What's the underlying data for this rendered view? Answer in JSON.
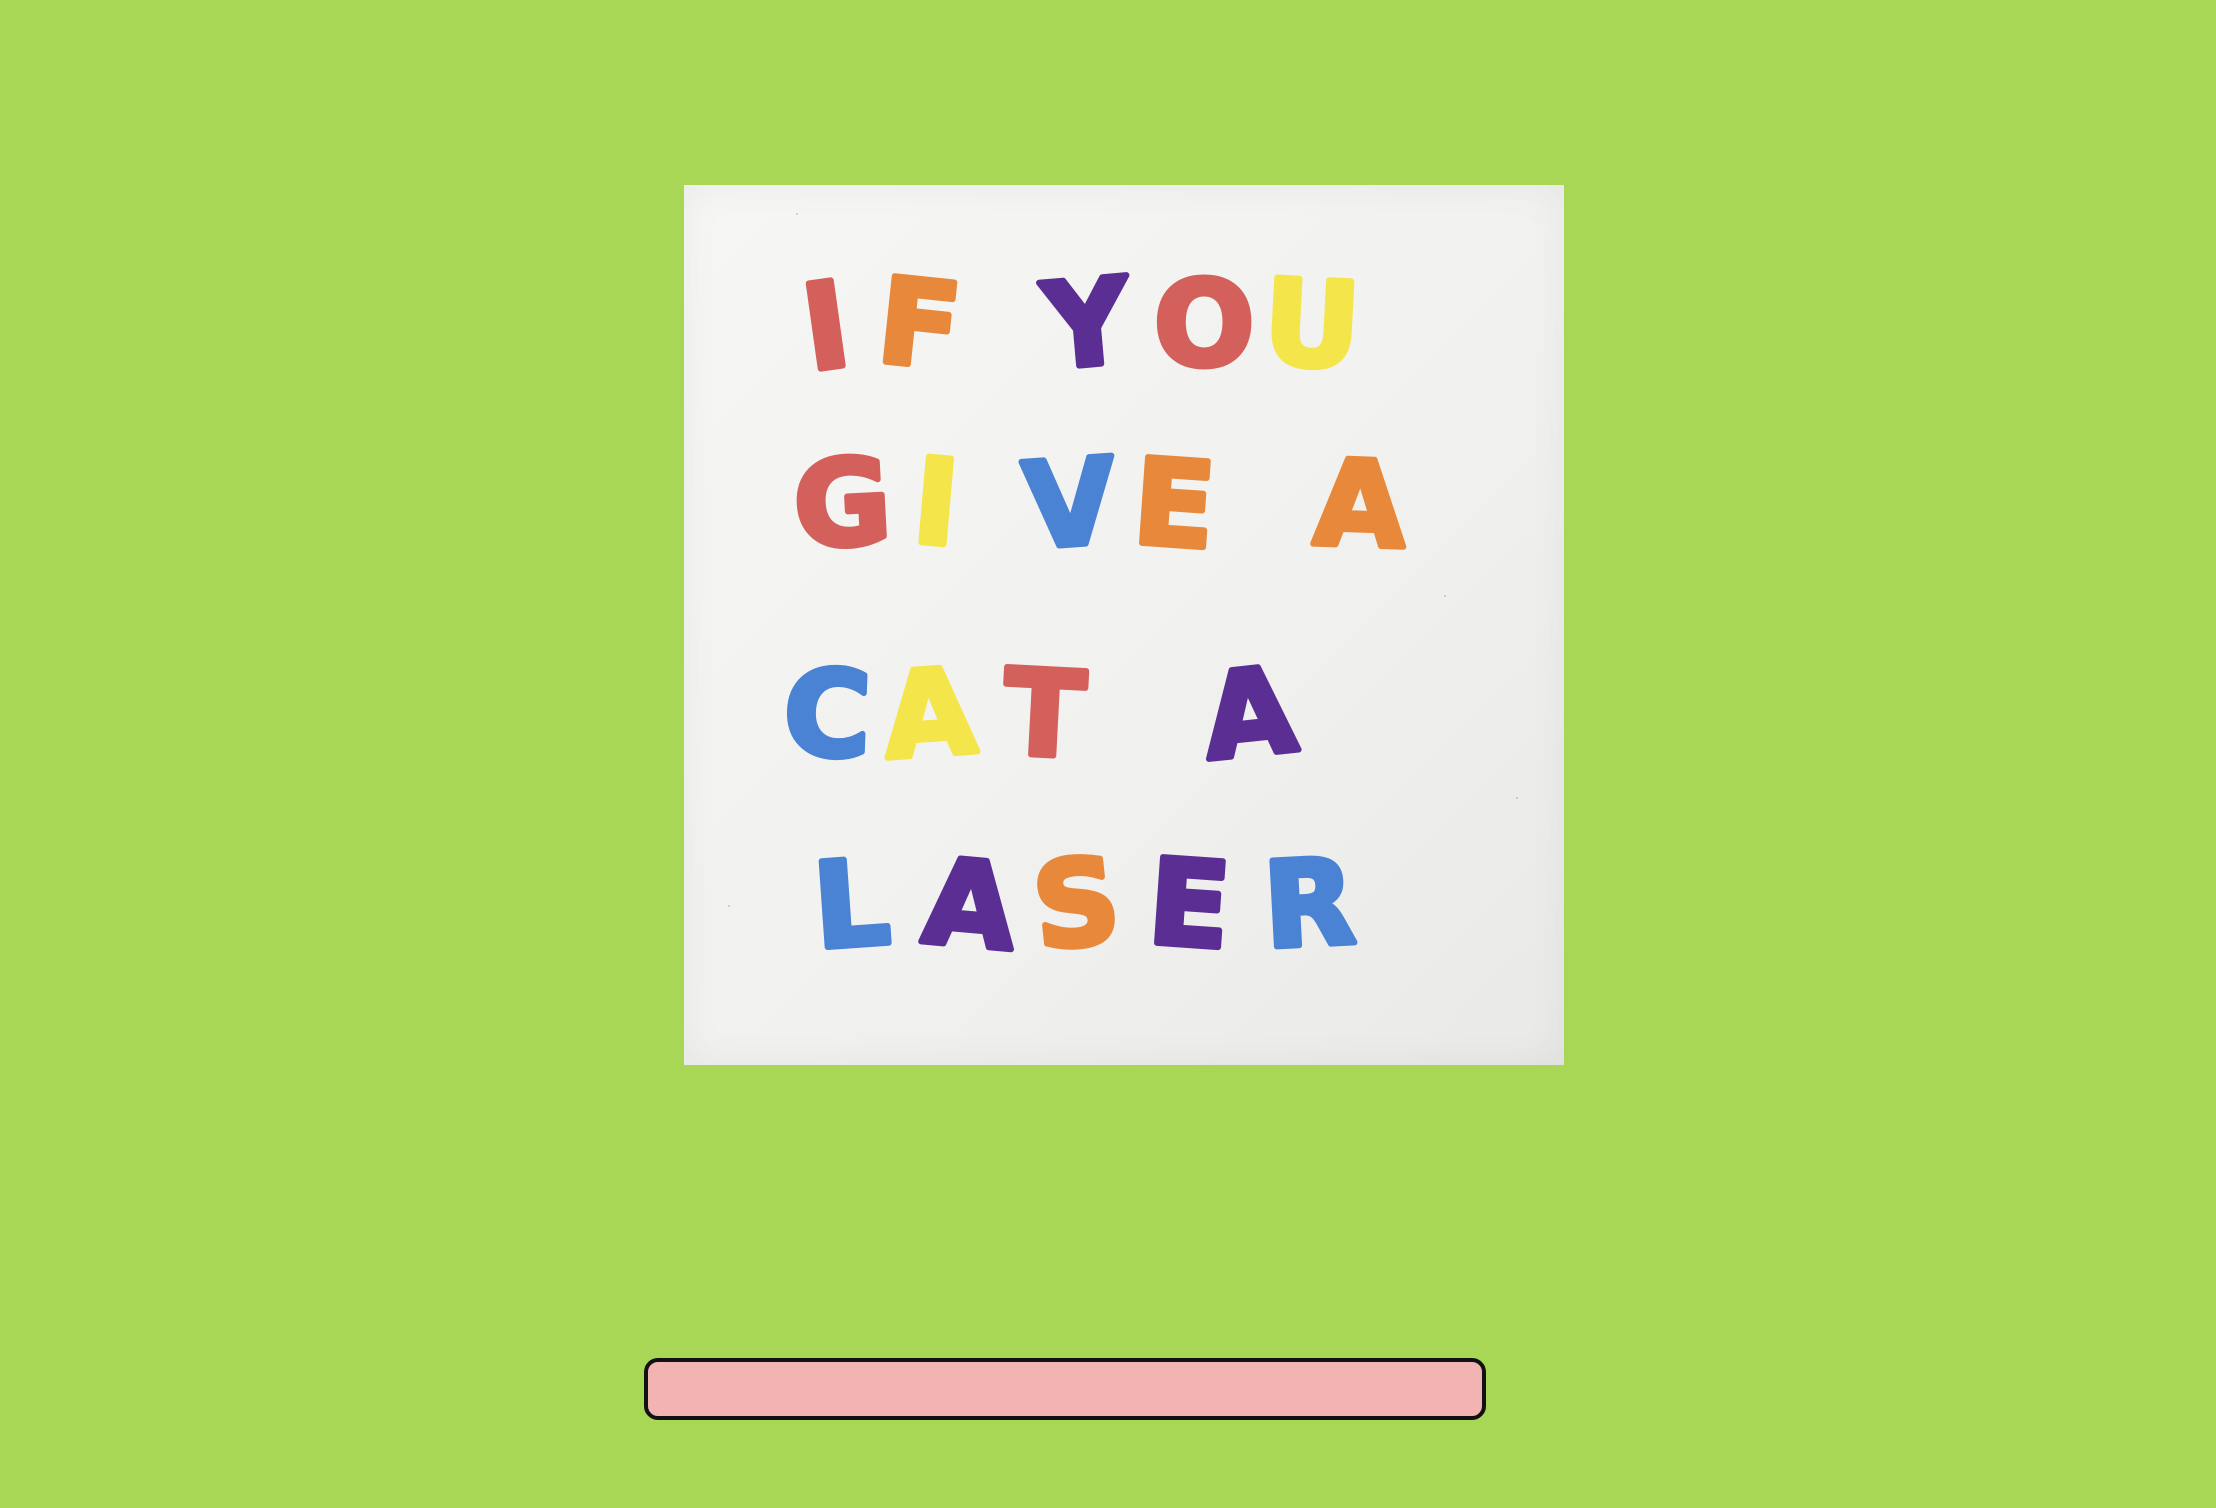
{
  "cover": {
    "title_lines": [
      [
        {
          "ch": "I",
          "color": "#d4605c"
        },
        {
          "ch": "F",
          "color": "#e8883a"
        },
        {
          "ch": " ",
          "color": ""
        },
        {
          "ch": "Y",
          "color": "#5a2e92"
        },
        {
          "ch": "O",
          "color": "#d4605c"
        },
        {
          "ch": "U",
          "color": "#f4e54a"
        }
      ],
      [
        {
          "ch": "G",
          "color": "#d4605c"
        },
        {
          "ch": "I",
          "color": "#f4e54a"
        },
        {
          "ch": "V",
          "color": "#4a82d4"
        },
        {
          "ch": "E",
          "color": "#e8883a"
        },
        {
          "ch": " ",
          "color": ""
        },
        {
          "ch": "A",
          "color": "#e8883a"
        }
      ],
      [
        {
          "ch": "C",
          "color": "#4a82d4"
        },
        {
          "ch": "A",
          "color": "#f4e54a"
        },
        {
          "ch": "T",
          "color": "#d4605c"
        },
        {
          "ch": " ",
          "color": ""
        },
        {
          "ch": "A",
          "color": "#5a2e92"
        }
      ],
      [
        {
          "ch": "L",
          "color": "#4a82d4"
        },
        {
          "ch": "A",
          "color": "#5a2e92"
        },
        {
          "ch": "S",
          "color": "#e8883a"
        },
        {
          "ch": "E",
          "color": "#5a2e92"
        },
        {
          "ch": "R",
          "color": "#4a82d4"
        }
      ]
    ]
  },
  "progress": {
    "value": 0,
    "track_color": "#f2b4b2",
    "border_color": "#111111"
  }
}
